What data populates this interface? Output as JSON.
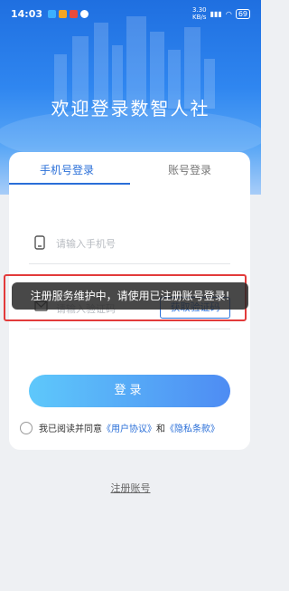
{
  "status_bar": {
    "time": "14:03",
    "network_speed": "3.30\nKB/s",
    "battery": "69"
  },
  "hero": {
    "title": "欢迎登录数智人社"
  },
  "tabs": [
    {
      "label": "手机号登录",
      "active": true
    },
    {
      "label": "账号登录",
      "active": false
    }
  ],
  "phone_field": {
    "placeholder": "请输入手机号",
    "icon": "phone-icon"
  },
  "code_field": {
    "placeholder": "请输入验证码",
    "icon": "envelope-icon",
    "button_label": "获取验证码"
  },
  "login_button": {
    "label": "登录"
  },
  "agreement": {
    "prefix": "我已阅读并同意",
    "user_agreement": "《用户协议》",
    "and": "和",
    "privacy_policy": "《隐私条款》"
  },
  "register": {
    "label": "注册账号"
  },
  "toast": {
    "message": "注册服务维护中，请使用已注册账号登录!"
  },
  "colors": {
    "accent": "#2a6fd8",
    "highlight": "#e23b3b",
    "hero": "#2f86f0"
  }
}
